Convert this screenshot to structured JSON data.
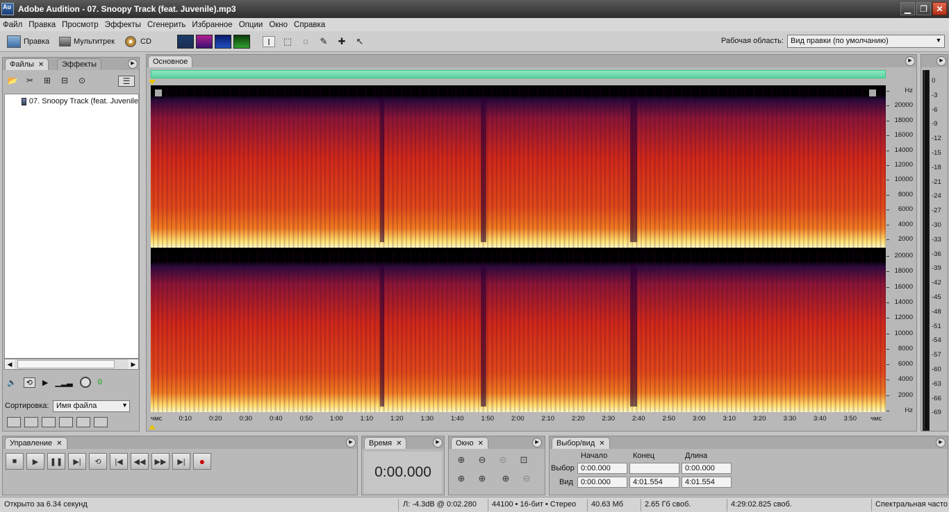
{
  "window": {
    "title": "Adobe Audition - 07. Snoopy Track (feat. Juvenile).mp3",
    "logo_text": "Au",
    "minimize": "▁",
    "maximize": "❐",
    "close": "✕"
  },
  "menu": [
    "Файл",
    "Правка",
    "Просмотр",
    "Эффекты",
    "Сгенерить",
    "Избранное",
    "Опции",
    "Окно",
    "Справка"
  ],
  "toolbar": {
    "edit_label": "Правка",
    "multitrack_label": "Мультитрек",
    "cd_label": "CD",
    "workspace_label": "Рабочая область:",
    "workspace_value": "Вид правки (по умолчанию)"
  },
  "files_panel": {
    "tab_files": "Файлы",
    "tab_effects": "Эффекты",
    "file_name": "07. Snoopy Track (feat. Juvenile",
    "volume_value": "0",
    "sort_label": "Сортировка:",
    "sort_value": "Имя файла"
  },
  "editor": {
    "tab_label": "Основное",
    "hz_unit": "Hz",
    "hz_top": [
      "20000",
      "18000",
      "16000",
      "14000",
      "12000",
      "10000",
      "8000",
      "6000",
      "4000",
      "2000"
    ],
    "hz_bottom": [
      "20000",
      "18000",
      "16000",
      "14000",
      "12000",
      "10000",
      "8000",
      "6000",
      "4000",
      "2000",
      "Hz"
    ],
    "time_labels": [
      "чмс",
      "0:10",
      "0:20",
      "0:30",
      "0:40",
      "0:50",
      "1:00",
      "1:10",
      "1:20",
      "1:30",
      "1:40",
      "1:50",
      "2:00",
      "2:10",
      "2:20",
      "2:30",
      "2:40",
      "2:50",
      "3:00",
      "3:10",
      "3:20",
      "3:30",
      "3:40",
      "3:50",
      "чмс"
    ]
  },
  "meter": {
    "db_labels": [
      "0",
      "-3",
      "-6",
      "-9",
      "-12",
      "-15",
      "-18",
      "-21",
      "-24",
      "-27",
      "-30",
      "-33",
      "-36",
      "-39",
      "-42",
      "-45",
      "-48",
      "-51",
      "-54",
      "-57",
      "-60",
      "-63",
      "-66",
      "-69"
    ]
  },
  "transport": {
    "tab_label": "Управление"
  },
  "time": {
    "tab_label": "Время",
    "value": "0:00.000"
  },
  "zoom": {
    "tab_label": "Окно"
  },
  "selection_view": {
    "tab_label": "Выбор/вид",
    "head_start": "Начало",
    "head_end": "Конец",
    "head_length": "Длина",
    "row_selection": "Выбор",
    "row_view": "Вид",
    "sel_start": "0:00.000",
    "sel_end": "",
    "sel_length": "0:00.000",
    "view_start": "0:00.000",
    "view_end": "4:01.554",
    "view_length": "4:01.554"
  },
  "status": {
    "opened": "Открыто за 6.34 секунд",
    "level": "Л: -4.3dB @  0:02.280",
    "format": "44100 • 16-бит • Стерео",
    "size": "40.63 Мб",
    "free_space": "2.65 Гб своб.",
    "free_time": "4:29:02.825 своб.",
    "view_mode": "Спектральная часто"
  },
  "colors": {
    "overview": "#5ccf9f",
    "spectrum_hot": "#ffe070",
    "spectrum_mid": "#d02818",
    "spectrum_low": "#2a0a3a",
    "playhead": "#e8c400",
    "record": "#cc0000"
  }
}
